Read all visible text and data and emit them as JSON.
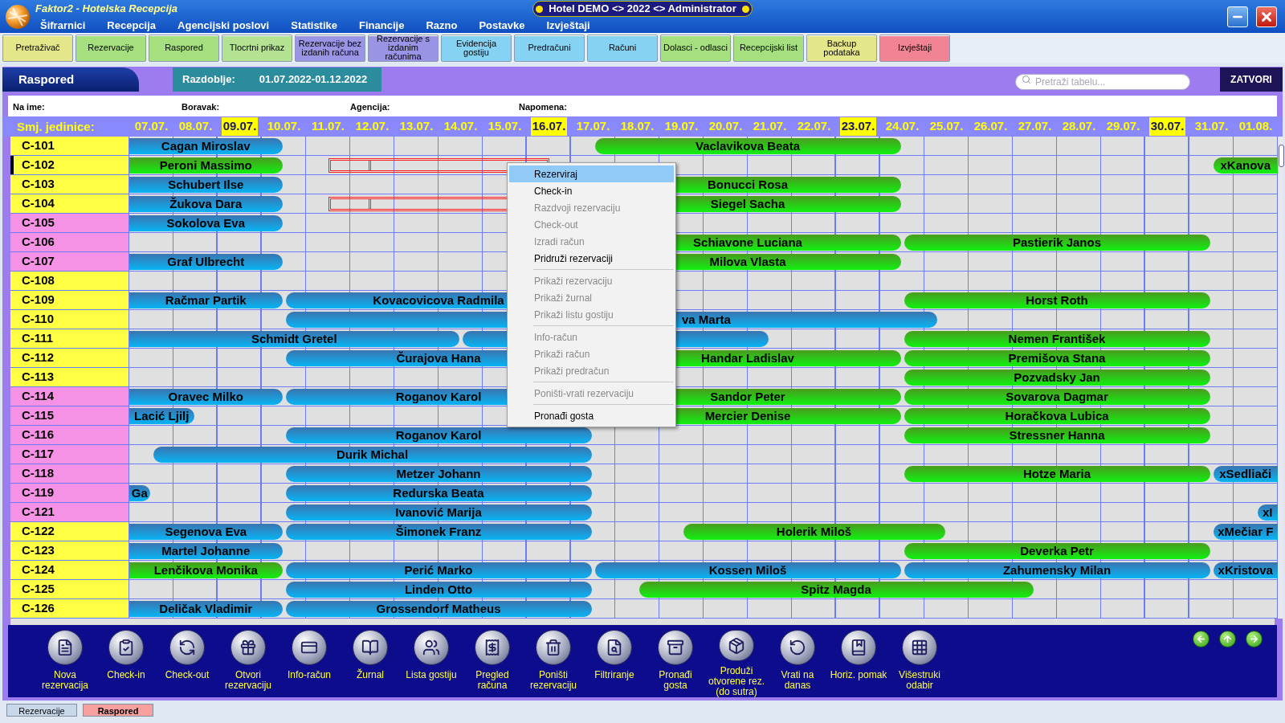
{
  "window": {
    "title": "Faktor2 - Hotelska Recepcija",
    "context": "Hotel DEMO <> 2022 <> Administrator"
  },
  "menu": [
    "Šifrarnici",
    "Recepcija",
    "Agencijski poslovi",
    "Statistike",
    "Financije",
    "Razno",
    "Postavke",
    "Izvještaji"
  ],
  "toolbar": [
    {
      "label": "Pretraživač",
      "color": "#e4e68a"
    },
    {
      "label": "Rezervacije",
      "color": "#a6e07e"
    },
    {
      "label": "Raspored",
      "color": "#a6e07e"
    },
    {
      "label": "Tlocrtni prikaz",
      "color": "#b2e292"
    },
    {
      "label": "Rezervacije bez izdanih računa",
      "color": "#9a94e4"
    },
    {
      "label": "Rezervacije s izdanim računima",
      "color": "#9a94e4"
    },
    {
      "label": "Evidencija gostiju",
      "color": "#86d2f2"
    },
    {
      "label": "Predračuni",
      "color": "#86d2f2"
    },
    {
      "label": "Računi",
      "color": "#86d2f2"
    },
    {
      "label": "Dolasci - odlasci",
      "color": "#a6e07e"
    },
    {
      "label": "Recepcijski list",
      "color": "#a6e07e"
    },
    {
      "label": "Backup podataka",
      "color": "#e4e68a"
    },
    {
      "label": "Izvještaji",
      "color": "#f08494"
    }
  ],
  "panel": {
    "title": "Raspored",
    "period_label": "Razdoblje:",
    "period": "01.07.2022-01.12.2022",
    "search": {
      "placeholder": "Pretraži tabelu..."
    },
    "close": "ZATVORI"
  },
  "filters": [
    "Na ime:",
    "Boravak:",
    "Agencija:",
    "Napomena:"
  ],
  "units_label": "Smj. jedinice:",
  "dates": [
    {
      "label": "07.07.",
      "highlighted": false
    },
    {
      "label": "08.07.",
      "highlighted": false
    },
    {
      "label": "09.07.",
      "highlighted": true
    },
    {
      "label": "10.07.",
      "highlighted": false
    },
    {
      "label": "11.07.",
      "highlighted": false
    },
    {
      "label": "12.07.",
      "highlighted": false
    },
    {
      "label": "13.07.",
      "highlighted": false
    },
    {
      "label": "14.07.",
      "highlighted": false
    },
    {
      "label": "15.07.",
      "highlighted": false
    },
    {
      "label": "16.07.",
      "highlighted": true
    },
    {
      "label": "17.07.",
      "highlighted": false
    },
    {
      "label": "18.07.",
      "highlighted": false
    },
    {
      "label": "19.07.",
      "highlighted": false
    },
    {
      "label": "20.07.",
      "highlighted": false
    },
    {
      "label": "21.07.",
      "highlighted": false
    },
    {
      "label": "22.07.",
      "highlighted": false
    },
    {
      "label": "23.07.",
      "highlighted": true
    },
    {
      "label": "24.07.",
      "highlighted": false
    },
    {
      "label": "25.07.",
      "highlighted": false
    },
    {
      "label": "26.07.",
      "highlighted": false
    },
    {
      "label": "27.07.",
      "highlighted": false
    },
    {
      "label": "28.07.",
      "highlighted": false
    },
    {
      "label": "29.07.",
      "highlighted": false
    },
    {
      "label": "30.07.",
      "highlighted": true
    },
    {
      "label": "31.07.",
      "highlighted": false
    },
    {
      "label": "01.08.",
      "highlighted": false
    }
  ],
  "rows": [
    {
      "room": "C-101",
      "color": "#ffff44",
      "current": false,
      "stays": [
        {
          "guest": "Cagan Miroslav",
          "checked_in": false
        },
        {
          "guest": "Vaclavikova Beata",
          "checked_in": true
        }
      ]
    },
    {
      "room": "C-102",
      "color": "#ffff44",
      "current": true,
      "selection": true,
      "stays": [
        {
          "guest": "Peroni Massimo",
          "checked_in": true
        },
        {
          "guest": "xKanova",
          "checked_in": true
        }
      ]
    },
    {
      "room": "C-103",
      "color": "#ffff44",
      "current": false,
      "stays": [
        {
          "guest": "Schubert Ilse",
          "checked_in": false
        },
        {
          "guest": "Bonucci Rosa",
          "checked_in": true
        }
      ]
    },
    {
      "room": "C-104",
      "color": "#ffff44",
      "current": false,
      "selection": true,
      "stays": [
        {
          "guest": "Žukova Dara",
          "checked_in": false
        },
        {
          "guest": "Siegel Sacha",
          "checked_in": true
        }
      ]
    },
    {
      "room": "C-105",
      "color": "#f592e6",
      "current": false,
      "stays": [
        {
          "guest": "Sokolova Eva",
          "checked_in": false
        }
      ]
    },
    {
      "room": "C-106",
      "color": "#f592e6",
      "current": false,
      "stays": [
        {
          "guest": "Schiavone Luciana",
          "checked_in": true
        },
        {
          "guest": "Pastierik Janos",
          "checked_in": true
        }
      ]
    },
    {
      "room": "C-107",
      "color": "#f592e6",
      "current": false,
      "stays": [
        {
          "guest": "Graf Ulbrecht",
          "checked_in": false
        },
        {
          "guest": "Milova Vlasta",
          "checked_in": true
        }
      ]
    },
    {
      "room": "C-108",
      "color": "#ffff44",
      "current": false,
      "stays": []
    },
    {
      "room": "C-109",
      "color": "#ffff44",
      "current": false,
      "stays": [
        {
          "guest": "Račmar Partik",
          "checked_in": false
        },
        {
          "guest": "Kovacovicova Radmila",
          "checked_in": false
        },
        {
          "guest": "Horst Roth",
          "checked_in": true
        }
      ]
    },
    {
      "room": "C-110",
      "color": "#ffff44",
      "current": false,
      "stays": [
        {
          "guest": "va Marta",
          "checked_in": false,
          "partly_hidden": true
        }
      ]
    },
    {
      "room": "C-111",
      "color": "#ffff44",
      "current": false,
      "stays": [
        {
          "guest": "Schmidt Gretel",
          "checked_in": false
        },
        {
          "checked_in": false
        },
        {
          "guest": "Nemen František",
          "checked_in": true
        }
      ]
    },
    {
      "room": "C-112",
      "color": "#ffff44",
      "current": false,
      "stays": [
        {
          "guest": "Čurajova Hana",
          "checked_in": false
        },
        {
          "guest": "Handar Ladislav",
          "checked_in": true
        },
        {
          "guest": "Premišova Stana",
          "checked_in": true
        }
      ]
    },
    {
      "room": "C-113",
      "color": "#ffff44",
      "current": false,
      "stays": [
        {
          "guest": "Pozvadsky Jan",
          "checked_in": true
        }
      ]
    },
    {
      "room": "C-114",
      "color": "#f592e6",
      "current": false,
      "stays": [
        {
          "guest": "Oravec Milko",
          "checked_in": false
        },
        {
          "guest": "Roganov Karol",
          "checked_in": false
        },
        {
          "guest": "Sandor Peter",
          "checked_in": true
        },
        {
          "guest": "Sovarova Dagmar",
          "checked_in": true
        }
      ]
    },
    {
      "room": "C-115",
      "color": "#f592e6",
      "current": false,
      "stays": [
        {
          "guest": "Lacić Ljilj",
          "checked_in": false
        },
        {
          "guest": "Mercier Denise",
          "checked_in": true
        },
        {
          "guest": "Horačkova Lubica",
          "checked_in": true
        }
      ]
    },
    {
      "room": "C-116",
      "color": "#f592e6",
      "current": false,
      "stays": [
        {
          "guest": "Roganov Karol",
          "checked_in": false
        },
        {
          "guest": "Stressner Hanna",
          "checked_in": true
        }
      ]
    },
    {
      "room": "C-117",
      "color": "#f592e6",
      "current": false,
      "stays": [
        {
          "guest": "Durik Michal",
          "checked_in": false
        }
      ]
    },
    {
      "room": "C-118",
      "color": "#f592e6",
      "current": false,
      "stays": [
        {
          "guest": "Metzer Johann",
          "checked_in": false
        },
        {
          "guest": "Hotze Maria",
          "checked_in": true
        },
        {
          "guest": "xSedliači",
          "checked_in": false
        }
      ]
    },
    {
      "room": "C-119",
      "color": "#f592e6",
      "current": false,
      "stays": [
        {
          "guest": "Ga",
          "checked_in": false
        },
        {
          "guest": "Redurska Beata",
          "checked_in": false
        }
      ]
    },
    {
      "room": "C-121",
      "color": "#f592e6",
      "current": false,
      "stays": [
        {
          "guest": "Ivanović Marija",
          "checked_in": false
        },
        {
          "guest": "xI",
          "checked_in": false
        }
      ]
    },
    {
      "room": "C-122",
      "color": "#ffff44",
      "current": false,
      "stays": [
        {
          "guest": "Segenova Eva",
          "checked_in": false
        },
        {
          "guest": "Šimonek Franz",
          "checked_in": false
        },
        {
          "guest": "Holerik Miloš",
          "checked_in": true
        },
        {
          "guest": "xMečiar F",
          "checked_in": false
        }
      ]
    },
    {
      "room": "C-123",
      "color": "#ffff44",
      "current": false,
      "stays": [
        {
          "guest": "Martel Johanne",
          "checked_in": false
        },
        {
          "guest": "Deverka Petr",
          "checked_in": true
        }
      ]
    },
    {
      "room": "C-124",
      "color": "#ffff44",
      "current": false,
      "stays": [
        {
          "guest": "Lenčikova Monika",
          "checked_in": true
        },
        {
          "guest": "Perić Marko",
          "checked_in": false
        },
        {
          "guest": "Kossen Miloš",
          "checked_in": false
        },
        {
          "guest": "Zahumensky Milan",
          "checked_in": false
        },
        {
          "guest": "xKristova",
          "checked_in": false
        }
      ]
    },
    {
      "room": "C-125",
      "color": "#ffff44",
      "current": false,
      "stays": [
        {
          "guest": "Linden Otto",
          "checked_in": false
        },
        {
          "guest": "Spitz Magda",
          "checked_in": true
        }
      ]
    },
    {
      "room": "C-126",
      "color": "#ffff44",
      "current": false,
      "stays": [
        {
          "guest": "Deličak Vladimir",
          "checked_in": false
        },
        {
          "guest": "Grossendorf Matheus",
          "checked_in": false
        }
      ]
    }
  ],
  "context_menu": [
    {
      "kind": "item",
      "label": "Rezerviraj",
      "disabled": false,
      "selected": true
    },
    {
      "kind": "item",
      "label": "Check-in",
      "disabled": false,
      "selected": false
    },
    {
      "kind": "item",
      "label": "Razdvoji rezervaciju",
      "disabled": true,
      "selected": false
    },
    {
      "kind": "item",
      "label": "Check-out",
      "disabled": true,
      "selected": false
    },
    {
      "kind": "item",
      "label": "Izradi račun",
      "disabled": true,
      "selected": false
    },
    {
      "kind": "item",
      "label": "Pridruži rezervaciji",
      "disabled": false,
      "selected": false
    },
    {
      "kind": "separator"
    },
    {
      "kind": "item",
      "label": "Prikaži rezervaciju",
      "disabled": true,
      "selected": false
    },
    {
      "kind": "item",
      "label": "Prikaži žurnal",
      "disabled": true,
      "selected": false
    },
    {
      "kind": "item",
      "label": "Prikaži listu gostiju",
      "disabled": true,
      "selected": false
    },
    {
      "kind": "separator"
    },
    {
      "kind": "item",
      "label": "Info-račun",
      "disabled": true,
      "selected": false
    },
    {
      "kind": "item",
      "label": "Prikaži račun",
      "disabled": true,
      "selected": false
    },
    {
      "kind": "item",
      "label": "Prikaži predračun",
      "disabled": true,
      "selected": false
    },
    {
      "kind": "separator"
    },
    {
      "kind": "item",
      "label": "Poništi-vrati rezervaciju",
      "disabled": true,
      "selected": false
    },
    {
      "kind": "separator"
    },
    {
      "kind": "item",
      "label": "Pronađi gosta",
      "disabled": false,
      "selected": false
    }
  ],
  "actions": [
    "Nova\nrezervacija",
    "Check-in",
    "Check-out",
    "Otvori\nrezervaciju",
    "Info-račun",
    "Žurnal",
    "Lista gostiju",
    "Pregled\nračuna",
    "Poništi\nrezervaciju",
    "Filtriranje",
    "Pronađi\ngosta",
    "Produži\notvorene rez.\n(do sutra)",
    "Vrati na\ndanas",
    "Horiz. pomak",
    "Višestruki\nodabir"
  ],
  "bottom_tabs": [
    {
      "label": "Rezervacije",
      "selected": false
    },
    {
      "label": "Raspored",
      "selected": true
    }
  ]
}
